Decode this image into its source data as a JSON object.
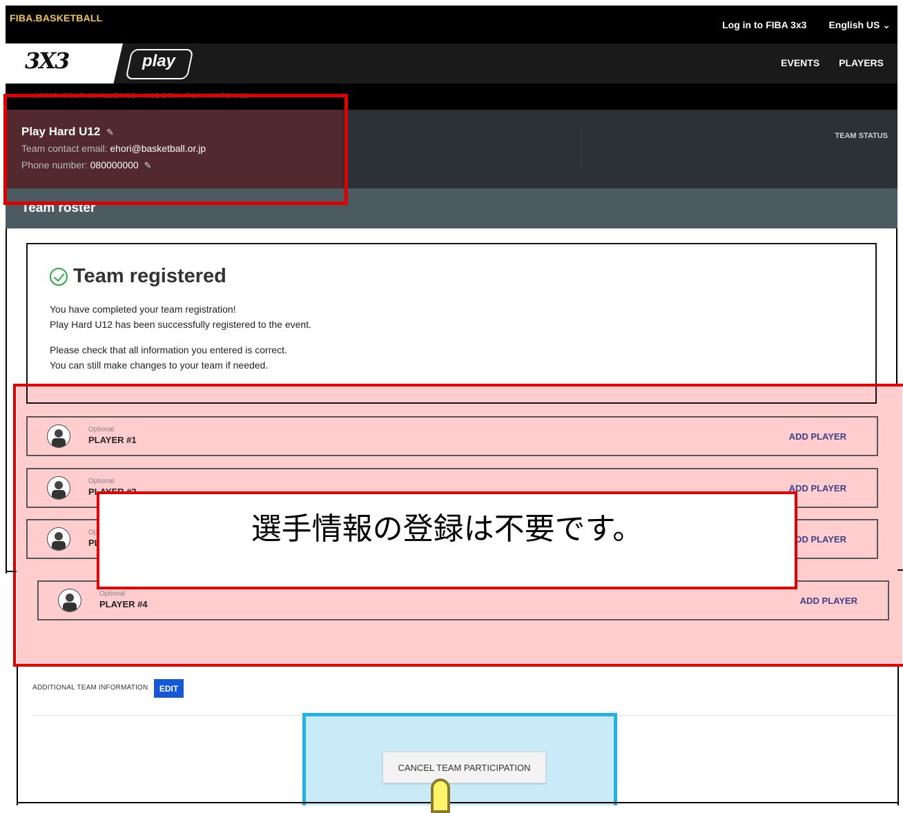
{
  "topbar": {
    "brand": "FIBA.BASKETBALL",
    "login": "Log in to FIBA 3x3",
    "language": "English US"
  },
  "nav": {
    "logo_3x3": "3X3",
    "logo_play": "play",
    "events": "EVENTS",
    "players": "PLAYERS"
  },
  "breadcrumb": "‹ JAPAN TOUR CHALLENGE   ‹ U12 BOY   ‹ PLAY HARD U12",
  "team": {
    "name": "Play Hard U12",
    "contact_label": "Team contact email: ",
    "contact_email": "ehori@basketball.or.jp",
    "phone_label": "Phone number: ",
    "phone": "080000000",
    "status_label": "TEAM STATUS"
  },
  "roster": {
    "title": "Team roster"
  },
  "registered": {
    "title": "Team registered",
    "line1": "You have completed your team registration!",
    "line2": "Play Hard U12 has been successfully registered to the event.",
    "line3": "Please check that all information you entered is correct.",
    "line4": "You can still make changes to your team if needed."
  },
  "players": [
    {
      "optional": "Optional",
      "label": "PLAYER #1",
      "action": "ADD PLAYER"
    },
    {
      "optional": "Optional",
      "label": "PLAYER #2",
      "action": "ADD PLAYER"
    },
    {
      "optional": "Optional",
      "label": "PLAYER #3",
      "action": "ADD PLAYER"
    },
    {
      "optional": "Optional",
      "label": "PLAYER #4",
      "action": "ADD PLAYER"
    }
  ],
  "note": "選手情報の登録は不要です。",
  "additional": {
    "label": "ADDITIONAL TEAM INFORMATION",
    "edit": "EDIT"
  },
  "cancel_label": "CANCEL TEAM PARTICIPATION",
  "colors": {
    "brand_yellow": "#f2c94c",
    "highlight_red": "#e00000",
    "highlight_cyan": "#23b2e6",
    "edit_blue": "#1657d6",
    "success_green": "#2aa845"
  }
}
